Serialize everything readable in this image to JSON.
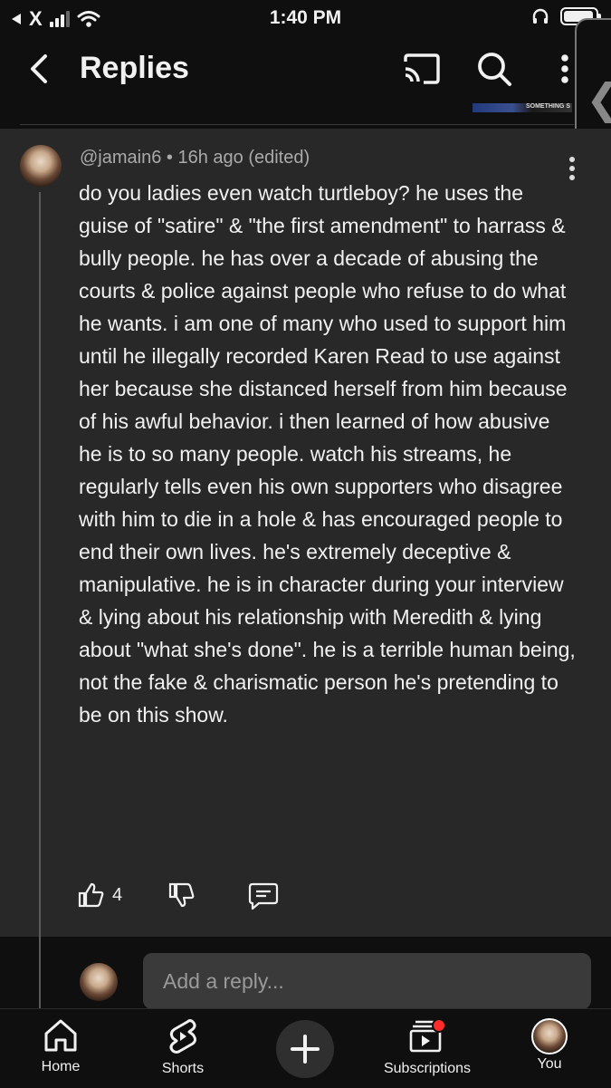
{
  "status_bar": {
    "back_app": "X",
    "time": "1:40 PM"
  },
  "header": {
    "title": "Replies"
  },
  "thumbnail_strip_text": "SOMETHING S",
  "comment": {
    "author": "@jamain6",
    "separator": "•",
    "timestamp": "16h ago (edited)",
    "text": "do you ladies even watch turtleboy? he uses the guise of \"satire\" & \"the first amendment\" to harrass & bully people. he has over a decade of abusing the courts & police against people who refuse to do what he wants. i am one of many who used to support him until he illegally recorded Karen Read to use against her because she distanced herself from him because of his awful behavior. i then learned of how abusive he is to so many people. watch his streams, he regularly tells even his own supporters who disagree with him to die in a hole & has encouraged people to end their own lives. he's extremely deceptive & manipulative. he is in character during your interview & lying about his relationship with Meredith & lying about \"what she's done\". he is a terrible human being, not the fake & charismatic person he's pretending to be on this show.",
    "like_count": "4"
  },
  "reply_box": {
    "placeholder": "Add a reply..."
  },
  "bottom_nav": {
    "home": "Home",
    "shorts": "Shorts",
    "subscriptions": "Subscriptions",
    "you": "You"
  },
  "icons": {
    "back": "chevron-left-icon",
    "cast": "cast-icon",
    "search": "search-icon",
    "more": "more-vert-icon",
    "like": "thumb-up-icon",
    "dislike": "thumb-down-icon",
    "reply": "reply-icon",
    "home": "home-icon",
    "shorts": "shorts-icon",
    "create": "plus-icon",
    "subscriptions": "subscriptions-icon"
  },
  "colors": {
    "background": "#0f0f0f",
    "comment_panel": "#282828",
    "notification_dot": "#ff2a2a"
  }
}
